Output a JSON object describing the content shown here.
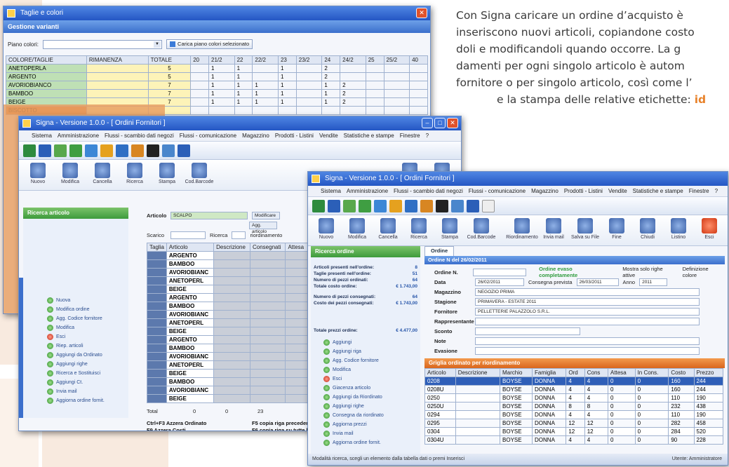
{
  "promo": {
    "line1": "Con Signa caricare un ordine d’acquisto è",
    "line2": "inseriscono nuovi articoli, copiandone costo",
    "line3": "doli e modificandoli quando occorre. La g",
    "line4": "damenti per ogni singolo articolo è  autom",
    "line5": "fornitore o per singolo articolo, così come l’",
    "line6a": "e la stampa delle relative etichette: ",
    "line6b": "id"
  },
  "colors": {
    "accent_orange": "#e8822a",
    "win_blue": "#2456c4",
    "green": "#3d9b3c"
  },
  "win1": {
    "title": "Taglie e colori",
    "header": "Gestione varianti",
    "piano_label": "Piano colori:",
    "load_button": "Carica piano colori selezionato",
    "columns": [
      "COLORE/TAGLIE",
      "RIMANENZA",
      "TOTALE",
      "20",
      "21/2",
      "22",
      "22/2",
      "23",
      "23/2",
      "24",
      "24/2",
      "25",
      "25/2",
      "40"
    ],
    "rows": [
      {
        "name": "ANETOPERLA",
        "tot": "5",
        "vals": [
          "1",
          "1",
          "",
          "1",
          "",
          "2"
        ]
      },
      {
        "name": "ARGENTO",
        "tot": "5",
        "vals": [
          "1",
          "1",
          "",
          "1",
          "",
          "2"
        ]
      },
      {
        "name": "AVORIOBIANCO",
        "tot": "7",
        "vals": [
          "1",
          "1",
          "1",
          "1",
          "",
          "1",
          "2"
        ]
      },
      {
        "name": "BAMBOO",
        "tot": "7",
        "vals": [
          "1",
          "1",
          "1",
          "1",
          "",
          "1",
          "2"
        ]
      },
      {
        "name": "BEIGE",
        "tot": "7",
        "vals": [
          "1",
          "1",
          "1",
          "1",
          "",
          "1",
          "2"
        ]
      },
      {
        "name": "BISCOTTO",
        "tot": "",
        "vals": []
      }
    ]
  },
  "win2": {
    "title": "Signa - Versione 1.0.0 - [ Ordini Fornitori ]",
    "menus": [
      "Sistema",
      "Amministrazione",
      "Flussi - scambio dati negozi",
      "Flussi - comunicazione",
      "Magazzino",
      "Prodotti - Listini",
      "Vendite",
      "Statistiche e stampe",
      "Finestre",
      "?"
    ],
    "tools": [
      "Nuovo",
      "Modifica",
      "Cancella",
      "Ricerca",
      "Stampa",
      "Cod.Barcode"
    ],
    "right_tools": [
      "Riordinamento",
      "Ordini mod."
    ],
    "panel_header": "Ricerca articolo",
    "article_label": "Articolo",
    "article_value": "SCALPO",
    "scarico_label": "Scarico",
    "ricerca_label": "Ricerca",
    "riordino_label": "riordinamento",
    "modif_btn": "Modificare",
    "add_btn": "Agg. articolo",
    "grid_headers": [
      "Taglia",
      "Articolo",
      "Descrizione",
      "Consegnati",
      "Attesa"
    ],
    "grid_rows": [
      "ARGENTO",
      "BAMBOO",
      "AVORIOBIANC",
      "ANETOPERL",
      "BEIGE",
      "ARGENTO",
      "BAMBOO",
      "AVORIOBIANC",
      "ANETOPERL",
      "BEIGE",
      "ARGENTO",
      "BAMBOO",
      "AVORIOBIANC",
      "ANETOPERL",
      "BEIGE",
      "BAMBOO",
      "AVORIOBIANC",
      "BEIGE"
    ],
    "total_label": "Total",
    "total_vals": [
      "0",
      "0",
      "23"
    ],
    "shortcuts": [
      [
        "Ctrl+F3 Azzera Ordinato",
        "F5 copia riga precedente"
      ],
      [
        "F9 Azzera Costi",
        "F6 copia riga su tutte le"
      ],
      [
        "F10 Azzera Prezzi",
        "F7 copia valore attuale"
      ],
      [
        "F11 Azzera Costi e Prezzi",
        "CTRL + F7 copia QT+ Q"
      ],
      [
        "F12 Ricalcola Prezzi",
        "F8 copia valore attuale"
      ]
    ],
    "tasks": [
      "Nuova",
      "Modifica ordine",
      "Agg. Codice fornitore",
      "Modifica",
      "Esci",
      "Riep. articoli",
      "Aggiungi da Ordinato",
      "Aggiungi righe",
      "Ricerca e Sostituisci",
      "Aggiungi Ct.",
      "Invia mail",
      "Aggiorna ordine fornit."
    ]
  },
  "win3": {
    "title": "Signa - Versione 1.0.0 - [ Ordini Fornitori ]",
    "menus": [
      "Sistema",
      "Amministrazione",
      "Flussi - scambio dati negozi",
      "Flussi - comunicazione",
      "Magazzino",
      "Prodotti - Listini",
      "Vendite",
      "Statistiche e stampe",
      "Finestre",
      "?"
    ],
    "tools": [
      "Nuovo",
      "Modifica",
      "Cancella",
      "Ricerca",
      "Stampa",
      "Cod.Barcode"
    ],
    "right_tools": [
      "Riordinamento",
      "Invia mail",
      "Salva su File",
      "Fine",
      "Chiudi",
      "Listino",
      "Esci"
    ],
    "panel_header": "Ricerca ordine",
    "summary": [
      {
        "label": "Articoli presenti nell'ordine:",
        "value": "8"
      },
      {
        "label": "Taglie presenti nell'ordine:",
        "value": "51"
      },
      {
        "label": "Numero di pezzi ordinati:",
        "value": "64"
      },
      {
        "label": "Totale costo ordine:",
        "value": "€ 1.743,00"
      },
      {
        "label": "Numero di pezzi consegnati:",
        "value": "64"
      },
      {
        "label": "Costo dei pezzi consegnati:",
        "value": "€ 1.743,00"
      },
      {
        "label": "Totale prezzi ordine:",
        "value": "€ 4.477,00"
      }
    ],
    "tab": "Ordine",
    "order_header": "Ordine N del 26/02/2011",
    "fields": [
      {
        "label": "Ordine N.",
        "value": ""
      },
      {
        "label": "Data",
        "value": "26/02/2011"
      },
      {
        "label": "Magazzino",
        "value": "NEGOZIO PRIMA"
      },
      {
        "label": "Stagione",
        "value": "PRIMAVERA - ESTATE 2011"
      },
      {
        "label": "Fornitore",
        "value": "PELLETTERIE PALAZZOLO S.R.L."
      },
      {
        "label": "Rappresentante",
        "value": ""
      },
      {
        "label": "Sconto",
        "value": ""
      },
      {
        "label": "Note",
        "value": ""
      },
      {
        "label": "Evasione",
        "value": ""
      }
    ],
    "consegna_label": "Consegna prevista",
    "consegna_value": "26/03/2011",
    "anno_label": "Anno",
    "anno_value": "2011",
    "check1": "Ordine evaso completamente",
    "check2": "Mostra solo righe attive",
    "check3": "Definizione colore",
    "righe_header": "Griglia ordinato per riordinamento",
    "row_headers": [
      "Articolo",
      "Descrizione",
      "Marchio",
      "Famiglia",
      "Ord",
      "Cons",
      "Attesa",
      "In Cons.",
      "Costo",
      "Prezzo"
    ],
    "rows": [
      [
        "0208",
        "",
        "BOYSE",
        "DONNA",
        "4",
        "4",
        "0",
        "0",
        "160",
        "244"
      ],
      [
        "0208U",
        "",
        "BOYSE",
        "DONNA",
        "4",
        "4",
        "0",
        "0",
        "160",
        "244"
      ],
      [
        "0250",
        "",
        "BOYSE",
        "DONNA",
        "4",
        "4",
        "0",
        "0",
        "110",
        "190"
      ],
      [
        "0250U",
        "",
        "BOYSE",
        "DONNA",
        "8",
        "8",
        "0",
        "0",
        "232",
        "438"
      ],
      [
        "0294",
        "",
        "BOYSE",
        "DONNA",
        "4",
        "4",
        "0",
        "0",
        "110",
        "190"
      ],
      [
        "0295",
        "",
        "BOYSE",
        "DONNA",
        "12",
        "12",
        "0",
        "0",
        "282",
        "458"
      ],
      [
        "0304",
        "",
        "BOYSE",
        "DONNA",
        "12",
        "12",
        "0",
        "0",
        "284",
        "520"
      ],
      [
        "0304U",
        "",
        "BOYSE",
        "DONNA",
        "4",
        "4",
        "0",
        "0",
        "90",
        "228"
      ]
    ],
    "tasks": [
      "Aggiungi",
      "Aggiungi riga",
      "Agg. Codice fornitore",
      "Modifica",
      "Esci",
      "Giacenza articolo",
      "Aggiungi da Riordinato",
      "Aggiungi righe",
      "Consegna da riordinato",
      "Aggiorna prezzi",
      "Invia mail",
      "Aggiorna ordine fornit."
    ],
    "status": "Modalità ricerca, scegli un elemento dalla tabella dati o premi Inserisci",
    "status_right": "Utente: Amministratore"
  }
}
